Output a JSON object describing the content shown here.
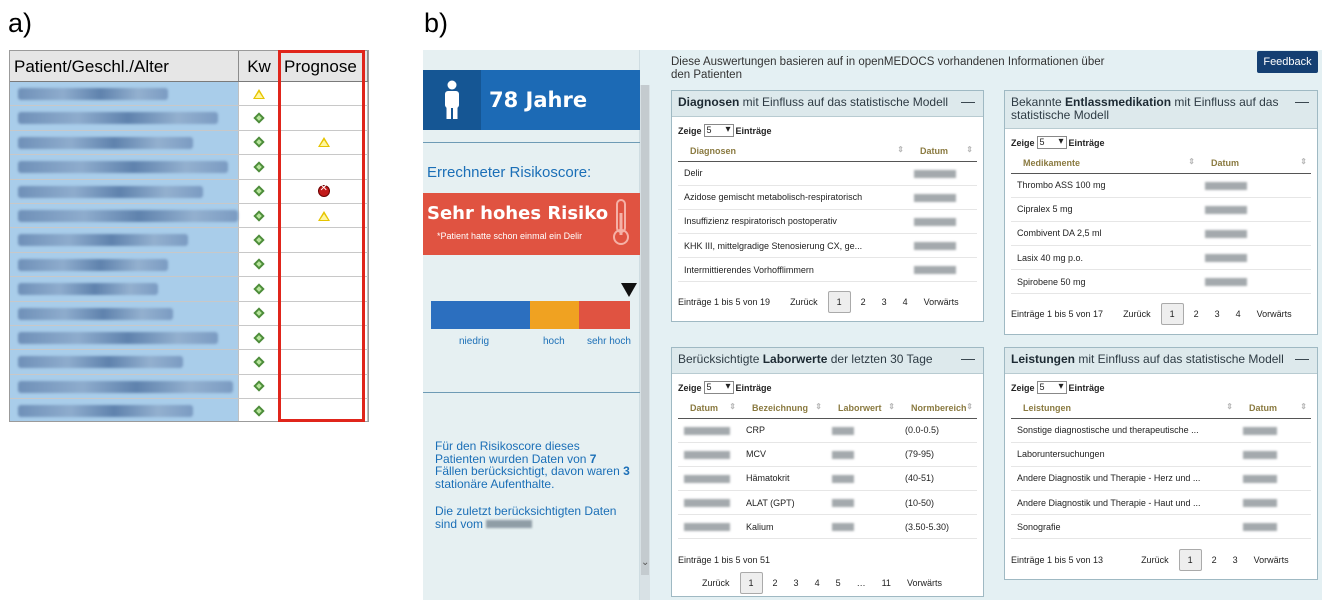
{
  "panel_a": {
    "label": "a)",
    "headers": [
      "Patient/Geschl./Alter",
      "Kw",
      "Prognose"
    ],
    "rows": [
      {
        "kw": "warn",
        "prog": ""
      },
      {
        "kw": "ok",
        "prog": ""
      },
      {
        "kw": "ok",
        "prog": "warn"
      },
      {
        "kw": "ok",
        "prog": ""
      },
      {
        "kw": "ok",
        "prog": "bad"
      },
      {
        "kw": "ok",
        "prog": "warn"
      },
      {
        "kw": "ok",
        "prog": ""
      },
      {
        "kw": "ok",
        "prog": ""
      },
      {
        "kw": "ok",
        "prog": ""
      },
      {
        "kw": "ok",
        "prog": ""
      },
      {
        "kw": "ok",
        "prog": ""
      },
      {
        "kw": "ok",
        "prog": ""
      },
      {
        "kw": "ok",
        "prog": ""
      },
      {
        "kw": "ok",
        "prog": ""
      }
    ]
  },
  "panel_b": {
    "label": "b)",
    "age": "78 Jahre",
    "risk_label": "Errechneter Risikoscore:",
    "risk_title": "Sehr hohes Risiko",
    "risk_sub": "*Patient hatte schon einmal ein Delir",
    "scale": {
      "low": "niedrig",
      "high": "hoch",
      "very_high": "sehr hoch",
      "colors": [
        "#2c6fbf",
        "#f0a221",
        "#e05341"
      ]
    },
    "info_1_pre": "Für den Risikoscore dieses Patienten wurden Daten von ",
    "info_1_n": "7",
    "info_1_mid": " Fällen berücksichtigt, davon waren ",
    "info_1_m": "3",
    "info_1_post": " stationäre Aufenthalte.",
    "info_2": "Die zuletzt berücksichtigten Daten sind vom",
    "intro": "Diese Auswertungen basieren auf in openMEDOCS vorhandenen Informationen über den Patienten",
    "feedback": "Feedback",
    "zeige": "Zeige",
    "zeige_val": "5",
    "eintraege": "Einträge",
    "zurueck": "Zurück",
    "vorwaerts": "Vorwärts",
    "diagnosen": {
      "title_b": "Diagnosen",
      "title_rest": " mit Einfluss auf das statistische Modell",
      "headers": [
        "Diagnosen",
        "Datum"
      ],
      "rows": [
        "Delir",
        "Azidose gemischt metabolisch-respiratorisch",
        "Insuffizienz respiratorisch postoperativ",
        "KHK III, mittelgradige Stenosierung CX, ge...",
        "Intermittierendes Vorhofflimmern"
      ],
      "info": "Einträge 1 bis 5 von 19",
      "pages": [
        "1",
        "2",
        "3",
        "4"
      ]
    },
    "medikation": {
      "title_pre": "Bekannte ",
      "title_b": "Entlassmedikation",
      "title_rest": " mit Einfluss auf das statistische Modell",
      "headers": [
        "Medikamente",
        "Datum"
      ],
      "rows": [
        "Thrombo ASS 100 mg",
        "Cipralex 5 mg",
        "Combivent DA 2,5 ml",
        "Lasix 40 mg p.o.",
        "Spirobene 50 mg"
      ],
      "info": "Einträge 1 bis 5 von 17",
      "pages": [
        "1",
        "2",
        "3",
        "4"
      ]
    },
    "labor": {
      "title_pre": "Berücksichtigte ",
      "title_b": "Laborwerte",
      "title_rest": " der letzten 30 Tage",
      "headers": [
        "Datum",
        "Bezeichnung",
        "Laborwert",
        "Normbereich"
      ],
      "rows": [
        {
          "name": "CRP",
          "range": "(0.0-0.5)"
        },
        {
          "name": "MCV",
          "range": "(79-95)"
        },
        {
          "name": "Hämatokrit",
          "range": "(40-51)"
        },
        {
          "name": "ALAT (GPT)",
          "range": "(10-50)"
        },
        {
          "name": "Kalium",
          "range": "(3.50-5.30)"
        }
      ],
      "info": "Einträge 1 bis 5 von 51",
      "pages": [
        "1",
        "2",
        "3",
        "4",
        "5",
        "…",
        "11"
      ]
    },
    "leistungen": {
      "title_b": "Leistungen",
      "title_rest": " mit Einfluss auf das statistische Modell",
      "headers": [
        "Leistungen",
        "Datum"
      ],
      "rows": [
        "Sonstige diagnostische und therapeutische ...",
        "Laboruntersuchungen",
        "Andere Diagnostik und Therapie - Herz und ...",
        "Andere Diagnostik und Therapie - Haut und ...",
        "Sonografie"
      ],
      "info": "Einträge 1 bis 5 von 13",
      "pages": [
        "1",
        "2",
        "3"
      ]
    }
  }
}
